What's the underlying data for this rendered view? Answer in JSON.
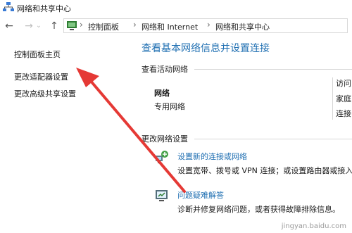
{
  "window": {
    "title": "网络和共享中心"
  },
  "nav": {
    "back": "←",
    "forward": "→",
    "up": "↑",
    "breadcrumbs": [
      "控制面板",
      "网络和 Internet",
      "网络和共享中心"
    ],
    "separator": "›"
  },
  "sidebar": {
    "items": [
      {
        "label": "控制面板主页"
      },
      {
        "label": "更改适配器设置"
      },
      {
        "label": "更改高级共享设置"
      }
    ]
  },
  "main": {
    "heading": "查看基本网络信息并设置连接",
    "active_label": "查看活动网络",
    "network_name": "网络",
    "network_type": "专用网络",
    "right_labels": [
      "访问",
      "家庭",
      "连接"
    ],
    "change_label": "更改网络设置",
    "tasks": [
      {
        "icon": "new-connection-icon",
        "link": "设置新的连接或网络",
        "desc": "设置宽带、拨号或 VPN 连接；或设置路由器或接入"
      },
      {
        "icon": "troubleshoot-icon",
        "link": "问题疑难解答",
        "desc": "诊断并修复网络问题，或者获得故障排除信息。"
      }
    ]
  },
  "watermark": "jingyan.baidu.com",
  "colors": {
    "accent_link": "#1f6fb2",
    "arrow": "#e53935"
  }
}
